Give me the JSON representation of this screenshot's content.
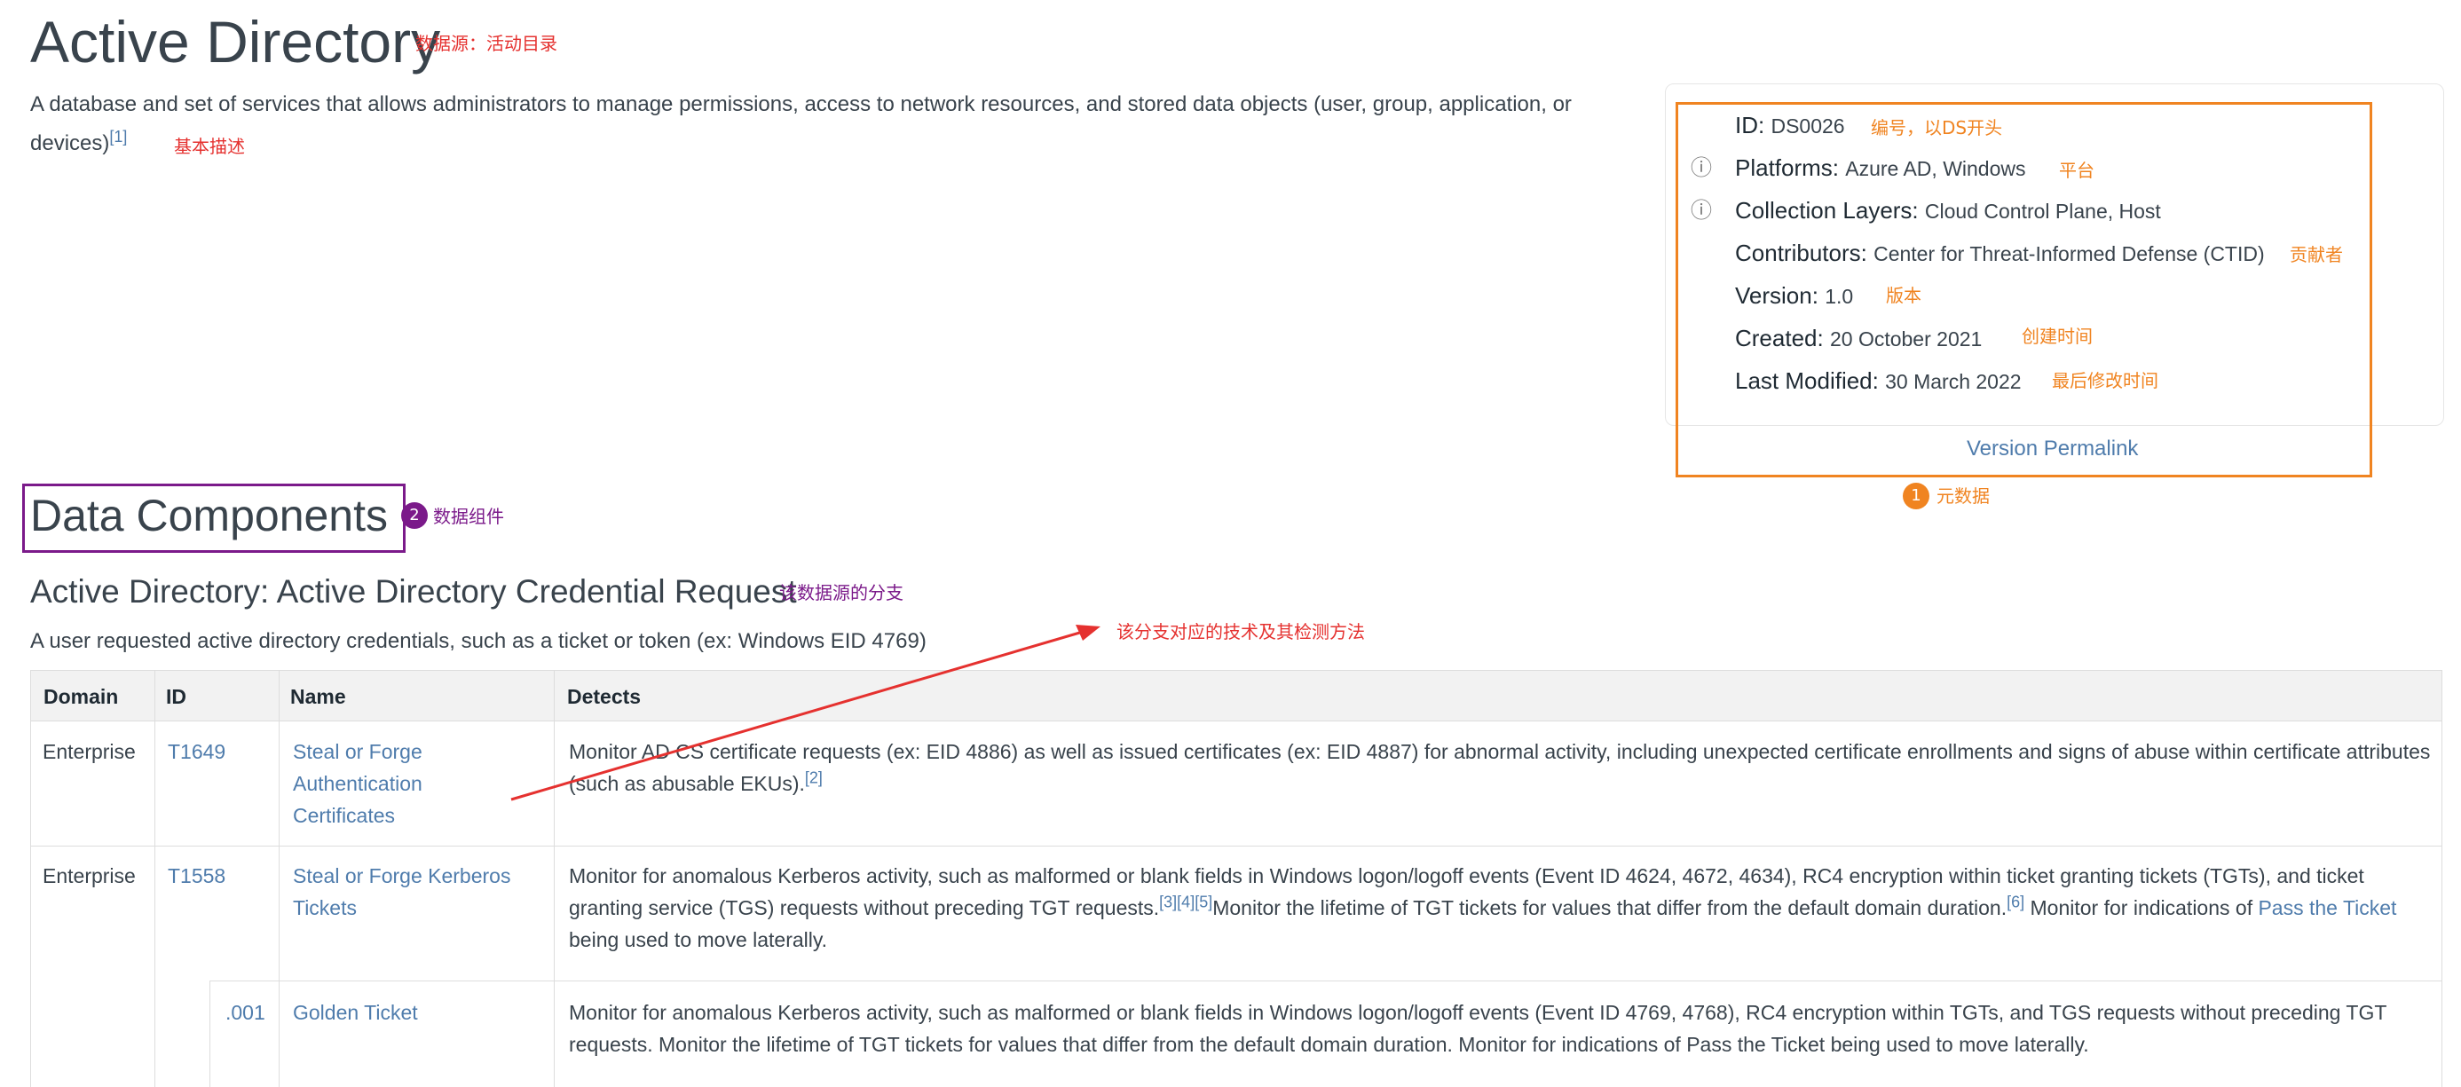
{
  "title": "Active Directory",
  "description": "A database and set of services that allows administrators to manage permissions, access to network resources, and stored data objects (user, group, application, or devices)",
  "description_ref": "[1]",
  "metadata": {
    "id_label": "ID:",
    "id_value": "DS0026",
    "platforms_label": "Platforms:",
    "platforms_value": "Azure AD, Windows",
    "layers_label": "Collection Layers:",
    "layers_value": "Cloud Control Plane, Host",
    "contributors_label": "Contributors:",
    "contributors_value": "Center for Threat-Informed Defense (CTID)",
    "version_label": "Version:",
    "version_value": "1.0",
    "created_label": "Created:",
    "created_value": "20 October 2021",
    "modified_label": "Last Modified:",
    "modified_value": "30 March 2022",
    "permalink": "Version Permalink"
  },
  "annotations": {
    "title_note": "数据源：活动目录",
    "desc_note": "基本描述",
    "id_note": "编号，以DS开头",
    "platform_note": "平台",
    "contributor_note": "贡献者",
    "version_note": "版本",
    "created_note": "创建时间",
    "modified_note": "最后修改时间",
    "meta_badge": "1",
    "meta_note": "元数据",
    "components_badge": "2",
    "components_note": "数据组件",
    "branch_note": "该数据源的分支",
    "arrow_note": "该分支对应的技术及其检测方法"
  },
  "colors": {
    "annotation_red": "#e5312f",
    "annotation_orange": "#f08421",
    "annotation_purple": "#7b1a8a",
    "link": "#4f7cac"
  },
  "components_heading": "Data Components",
  "component": {
    "title": "Active Directory: Active Directory Credential Request",
    "description": "A user requested active directory credentials, such as a ticket or token (ex: Windows EID 4769)"
  },
  "table": {
    "headers": [
      "Domain",
      "ID",
      "Name",
      "Detects"
    ],
    "rows": [
      {
        "domain": "Enterprise",
        "id": "T1649",
        "name": "Steal or Forge Authentication Certificates",
        "detects": "Monitor AD CS certificate requests (ex: EID 4886) as well as issued certificates (ex: EID 4887) for abnormal activity, including unexpected certificate enrollments and signs of abuse within certificate attributes (such as abusable EKUs).",
        "ref": "[2]"
      },
      {
        "domain": "Enterprise",
        "id": "T1558",
        "name": "Steal or Forge Kerberos Tickets",
        "detects_a": "Monitor for anomalous Kerberos activity, such as malformed or blank fields in Windows logon/logoff events (Event ID 4624, 4672, 4634), RC4 encryption within ticket granting tickets (TGTs), and ticket granting service (TGS) requests without preceding TGT requests.",
        "ref_a": "[3][4][5]",
        "detects_b": "Monitor the lifetime of TGT tickets for values that differ from the default domain duration.",
        "ref_b": "[6]",
        "detects_c": " Monitor for indications of ",
        "link": "Pass the Ticket",
        "detects_d": " being used to move laterally."
      },
      {
        "sub_id": ".001",
        "name": "Golden Ticket",
        "detects": "Monitor for anomalous Kerberos activity, such as malformed or blank fields in Windows logon/logoff events (Event ID 4769, 4768), RC4 encryption within TGTs, and TGS requests without preceding TGT requests. Monitor the lifetime of TGT tickets for values that differ from the default domain duration. Monitor for indications of Pass the Ticket being used to move laterally."
      }
    ]
  }
}
